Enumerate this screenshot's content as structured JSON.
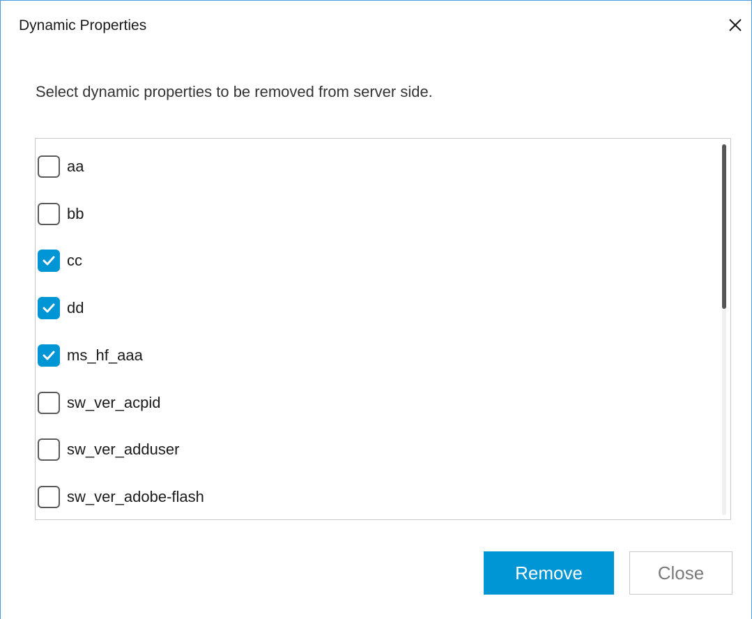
{
  "dialog": {
    "title": "Dynamic Properties",
    "instruction": "Select dynamic properties to be removed from server side.",
    "items": [
      {
        "label": "aa",
        "checked": false
      },
      {
        "label": "bb",
        "checked": false
      },
      {
        "label": "cc",
        "checked": true
      },
      {
        "label": "dd",
        "checked": true
      },
      {
        "label": "ms_hf_aaa",
        "checked": true
      },
      {
        "label": "sw_ver_acpid",
        "checked": false
      },
      {
        "label": "sw_ver_adduser",
        "checked": false
      },
      {
        "label": "sw_ver_adobe-flash",
        "checked": false
      }
    ],
    "remove_label": "Remove",
    "close_label": "Close"
  },
  "colors": {
    "accent": "#0096d6",
    "window_border": "#4a9be0"
  },
  "icons": {
    "close": "close-icon",
    "check": "checkmark-icon"
  }
}
